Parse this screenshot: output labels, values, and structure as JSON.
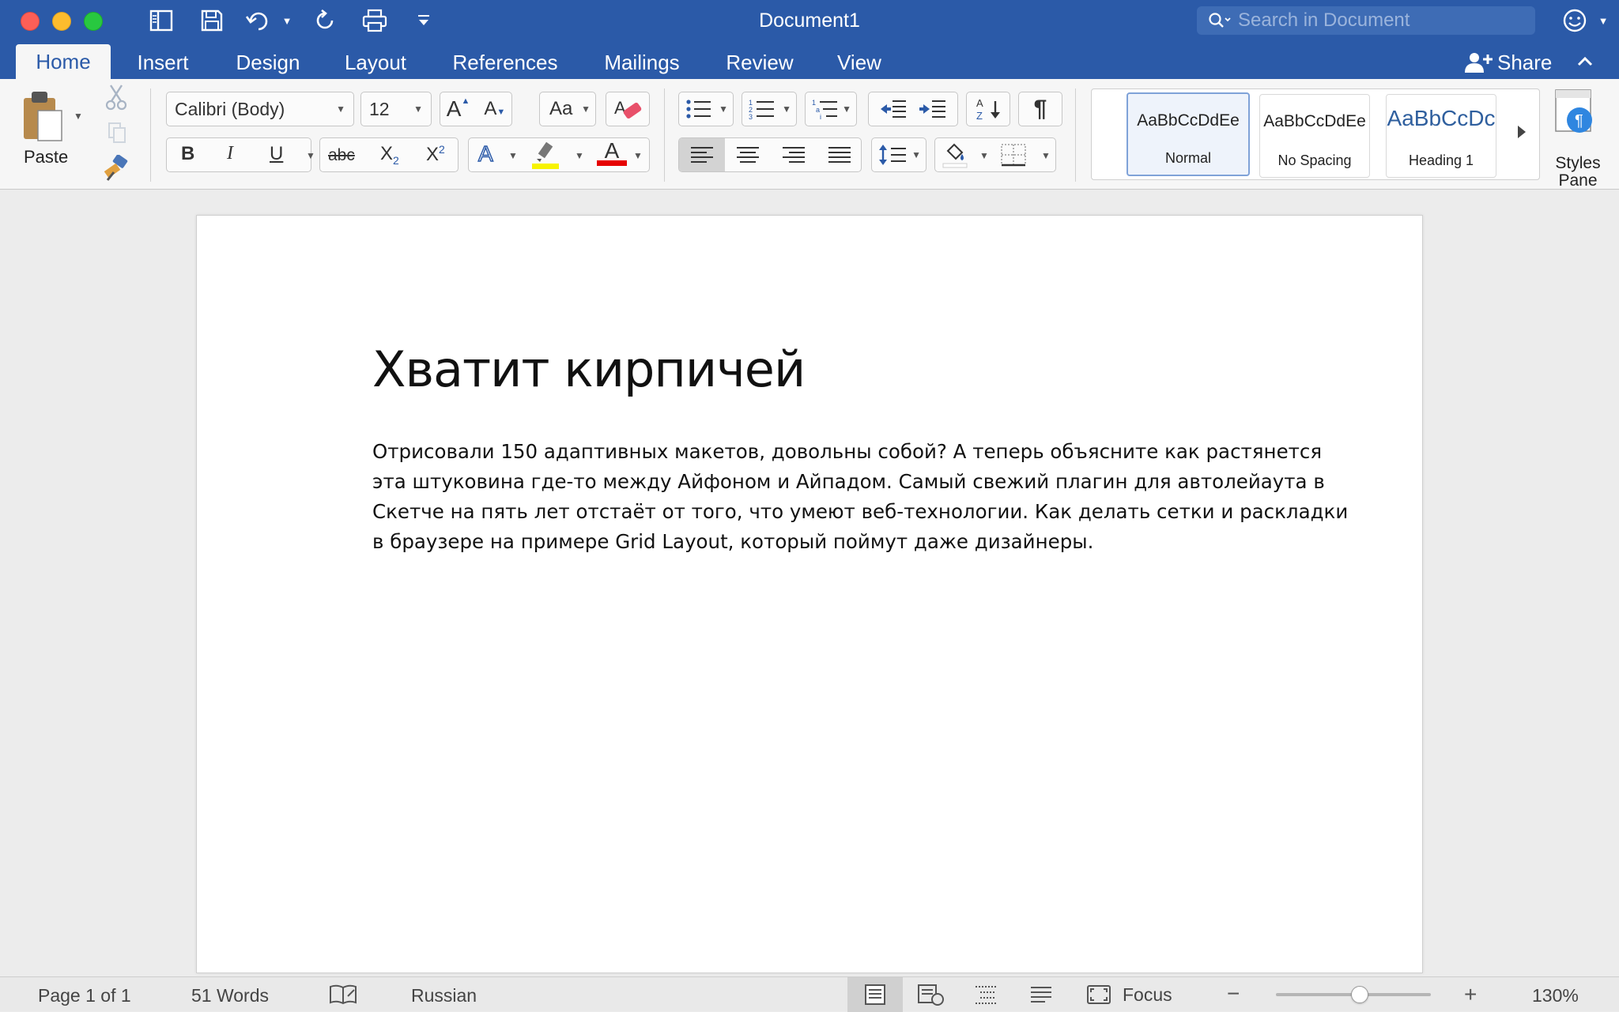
{
  "window": {
    "title": "Document1"
  },
  "search": {
    "placeholder": "Search in Document"
  },
  "tabs": [
    {
      "label": "Home"
    },
    {
      "label": "Insert"
    },
    {
      "label": "Design"
    },
    {
      "label": "Layout"
    },
    {
      "label": "References"
    },
    {
      "label": "Mailings"
    },
    {
      "label": "Review"
    },
    {
      "label": "View"
    }
  ],
  "share_label": "Share",
  "ribbon": {
    "paste_label": "Paste",
    "font_name": "Calibri (Body)",
    "font_size": "12",
    "bold": "B",
    "italic": "I",
    "underline": "U",
    "strike": "abc",
    "subscript": "X",
    "subscript_sub": "2",
    "superscript": "X",
    "superscript_sup": "2",
    "grow_font": "A",
    "shrink_font": "A",
    "change_case": "Aa",
    "text_effects": "A",
    "font_color_glyph": "A",
    "highlight_color": "#f7f300",
    "font_color": "#e60000",
    "pilcrow": "¶",
    "styles": [
      {
        "sample": "AaBbCcDdEe",
        "name": "Normal"
      },
      {
        "sample": "AaBbCcDdEe",
        "name": "No Spacing"
      },
      {
        "sample": "AaBbCcDc",
        "name": "Heading 1"
      }
    ],
    "styles_pane_line1": "Styles",
    "styles_pane_line2": "Pane"
  },
  "document": {
    "heading": "Хватит кирпичей",
    "body": "Отрисовали 150 адаптивных макетов, довольны собой? А теперь объясните как растянется эта штуковина где-то между Айфоном и Айпадом. Самый свежий плагин для автолейаута в Скетче на пять лет отстаёт от того, что умеют веб-технологии. Как делать сетки и раскладки в браузере на примере Grid Layout, который поймут даже дизайнеры."
  },
  "status": {
    "page": "Page 1 of 1",
    "words": "51 Words",
    "language": "Russian",
    "focus": "Focus",
    "zoom_text": "130%",
    "zoom_slider_fraction": 0.54
  },
  "colors": {
    "accent": "#2b5aa8"
  }
}
